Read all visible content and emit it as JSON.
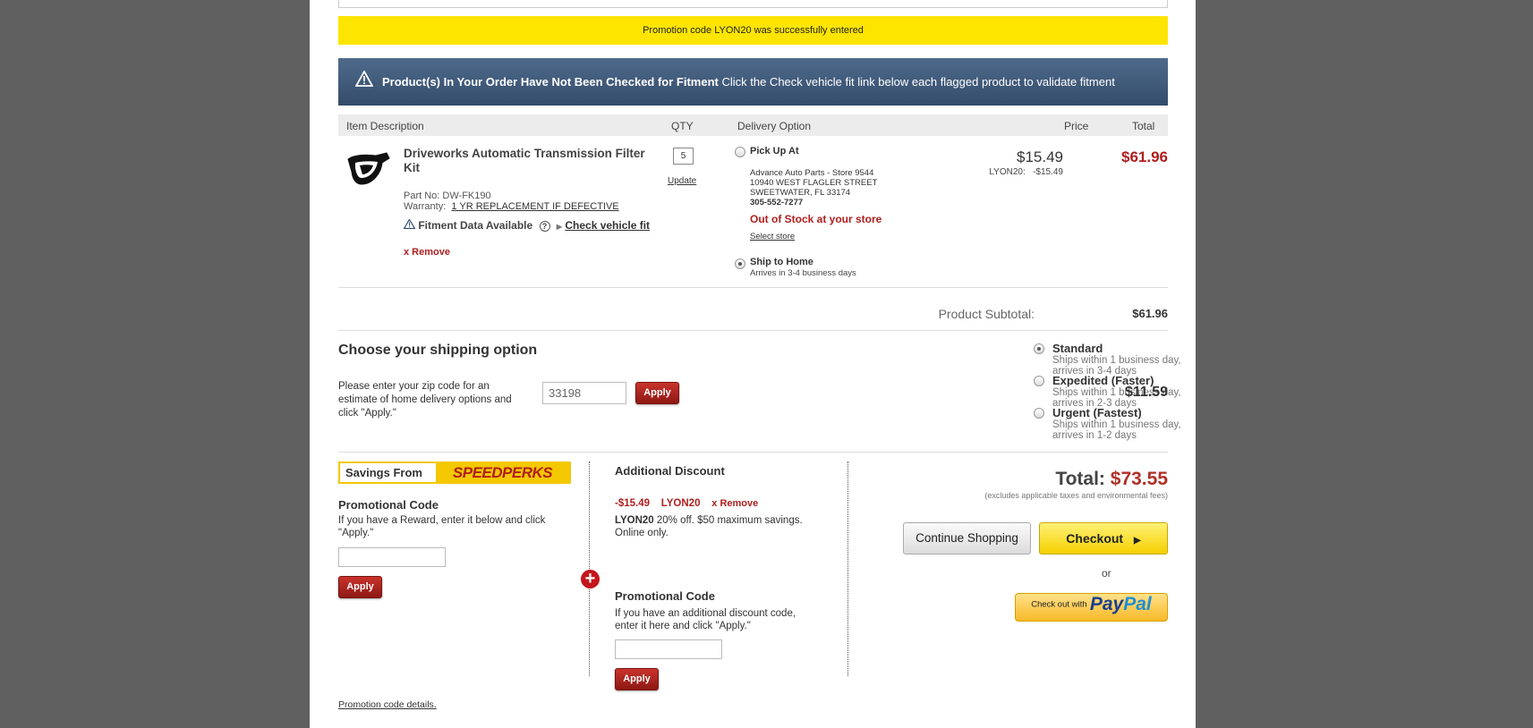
{
  "promo_banner": "Promotion code LYON20 was successfully entered",
  "fitment_banner": {
    "bold": "Product(s) In Your Order Have Not Been Checked for Fitment",
    "text": " Click the Check vehicle fit link below each flagged product to validate fitment"
  },
  "table_headers": {
    "item": "Item Description",
    "qty": "QTY",
    "delivery": "Delivery Option",
    "price": "Price",
    "total": "Total"
  },
  "product": {
    "name": "Driveworks Automatic Transmission Filter Kit",
    "part_no": "Part No: DW-FK190",
    "warranty_label": "Warranty:",
    "warranty_link": "1 YR REPLACEMENT IF DEFECTIVE",
    "fitment_label": "Fitment Data Available",
    "check_fit": "Check vehicle fit",
    "remove": "x Remove",
    "qty": "5",
    "update": "Update",
    "price": "$15.49",
    "discount_code": "LYON20:",
    "discount_amount": "-$15.49",
    "total": "$61.96"
  },
  "delivery": {
    "pickup_label": "Pick Up At",
    "store_name": "Advance Auto Parts - Store  9544",
    "store_street": "10940 WEST FLAGLER STREET",
    "store_city": "SWEETWATER, FL  33174",
    "store_phone": "305-552-7277",
    "out_of_stock": "Out of Stock at your store",
    "select_store": "Select store",
    "ship_home_label": "Ship to Home",
    "ship_home_sub": "Arrives in 3-4 business days"
  },
  "subtotal": {
    "label": "Product Subtotal:",
    "value": "$61.96"
  },
  "shipping": {
    "title": "Choose your shipping option",
    "desc": "Please enter your zip code for an estimate of home delivery options and click \"Apply.\"",
    "zip": "33198",
    "apply": "Apply",
    "options": [
      {
        "name": "Standard",
        "sub": "Ships within 1 business day, arrives in 3-4 days",
        "selected": true
      },
      {
        "name": "Expedited (Faster)",
        "sub": "Ships within 1 business day, arrives in 2-3 days",
        "selected": false
      },
      {
        "name": "Urgent (Fastest)",
        "sub": "Ships within 1 business day, arrives in 1-2 days",
        "selected": false
      }
    ],
    "price": "$11.59"
  },
  "speedperks": {
    "savings_from": "Savings From",
    "logo": "SPEEDPERKS",
    "promo_title": "Promotional Code",
    "promo_desc": "If you have a Reward, enter it below and click \"Apply.\"",
    "apply": "Apply"
  },
  "additional": {
    "title": "Additional Discount",
    "amount": "-$15.49",
    "code": "LYON20",
    "remove": "x Remove",
    "desc_bold": "LYON20",
    "desc": " 20% off.  $50 maximum savings.",
    "desc2": " Online only.",
    "promo_title": "Promotional Code",
    "promo_desc": "If you have an additional discount code, enter it here and click \"Apply.\"",
    "apply": "Apply"
  },
  "totals": {
    "label": "Total:",
    "value": "$73.55",
    "note": "(excludes applicable taxes and environmental fees)",
    "continue": "Continue Shopping",
    "checkout": "Checkout",
    "or": "or",
    "paypal_small": "Check out with",
    "paypal_pay": "Pay",
    "paypal_pal": "Pal"
  },
  "promo_details": "Promotion code details."
}
